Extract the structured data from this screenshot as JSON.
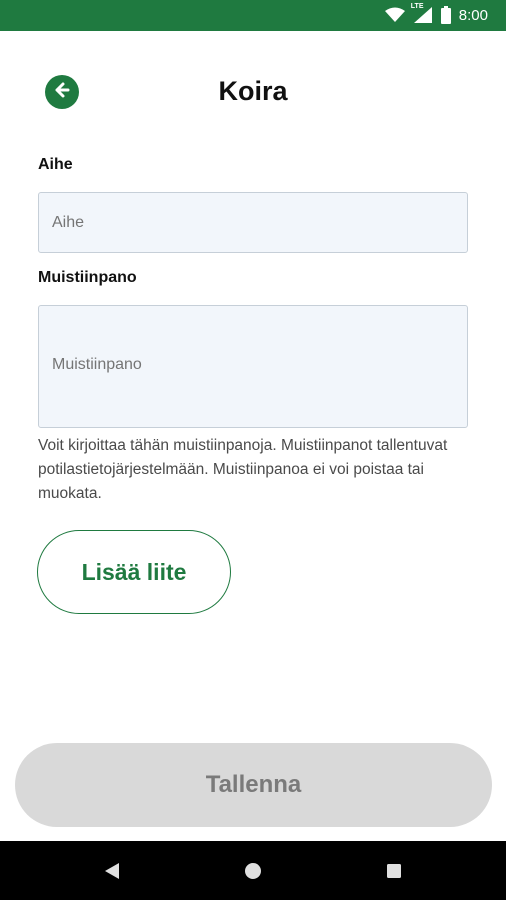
{
  "status_bar": {
    "time": "8:00",
    "network": "LTE"
  },
  "header": {
    "title": "Koira"
  },
  "form": {
    "subject_label": "Aihe",
    "subject_placeholder": "Aihe",
    "subject_value": "",
    "note_label": "Muistiinpano",
    "note_placeholder": "Muistiinpano",
    "note_value": "",
    "hint_text": "Voit kirjoittaa tähän muistiinpanoja. Muistiinpanot tallentuvat potilastietojärjestelmään. Muistiinpanoa ei voi poistaa tai muokata."
  },
  "buttons": {
    "attach_label": "Lisää liite",
    "save_label": "Tallenna"
  },
  "colors": {
    "brand_green": "#1f7a40",
    "disabled_gray": "#d9d9d9",
    "field_bg": "#f2f6fb"
  },
  "icons": {
    "back": "arrow-left-circle-icon",
    "wifi": "wifi-icon",
    "signal": "signal-icon",
    "battery": "battery-icon",
    "nav_back": "triangle-back-icon",
    "nav_home": "circle-home-icon",
    "nav_recents": "square-recents-icon"
  }
}
